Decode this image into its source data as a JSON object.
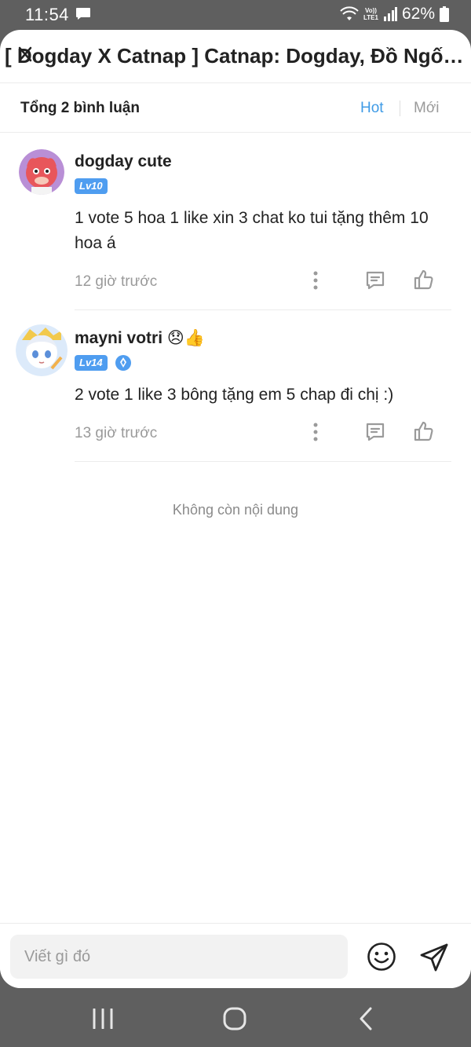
{
  "status_bar": {
    "time": "11:54",
    "network_top": "Vo))",
    "network_bottom": "LTE1",
    "battery": "62%"
  },
  "header": {
    "title": "[ Dogday X Catnap ] Catnap: Dogday, Đồ Ngốc Của Tôi"
  },
  "summary": {
    "count_label": "Tổng 2 bình luận",
    "sort_hot": "Hot",
    "sort_new": "Mới"
  },
  "comments": [
    {
      "username": "dogday cute",
      "level": "Lv10",
      "text": "1 vote 5 hoa 1 like xin 3 chat ko tui tặng thêm 10 hoa á",
      "time": "12 giờ trước"
    },
    {
      "username": "mayni votri",
      "username_emoji": "😞👍",
      "level": "Lv14",
      "text": "2 vote 1 like 3 bông tặng em 5 chap đi chị :)",
      "time": "13 giờ trước"
    }
  ],
  "end_note": "Không còn nội dung",
  "composer": {
    "placeholder": "Viết gì đó"
  },
  "colors": {
    "accent": "#3f9be6",
    "level_badge": "#4f9df0",
    "muted_text": "#9a9a9a",
    "system_bar": "#5f5f5f"
  },
  "icons": {
    "more": "more-vertical-icon",
    "reply": "reply-comment-icon",
    "like": "thumbs-up-icon",
    "emoji": "smiley-icon",
    "send": "send-icon"
  }
}
